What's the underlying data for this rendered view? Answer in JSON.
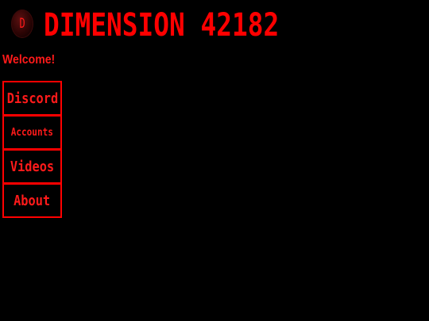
{
  "header": {
    "logo_letter": "D",
    "title": "DIMENSION 42182"
  },
  "welcome_text": "Welcome!",
  "nav": {
    "items": [
      {
        "label": "Discord"
      },
      {
        "label": "Accounts"
      },
      {
        "label": "Videos"
      },
      {
        "label": "About"
      }
    ]
  },
  "colors": {
    "background": "#000000",
    "accent": "#ff0000"
  }
}
